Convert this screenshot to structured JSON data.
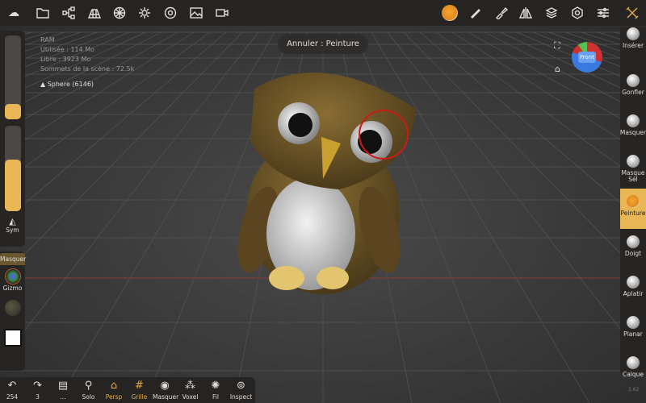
{
  "topbar": {
    "left_icons": [
      "nomad-logo-icon",
      "folder-icon",
      "scene-graph-icon",
      "topology-icon",
      "material-sphere-icon",
      "light-icon",
      "postprocess-icon",
      "image-background-icon",
      "camera-icon"
    ],
    "right_icons": [
      "material-preview-icon",
      "brush-stroke-icon",
      "paint-brush-icon",
      "symmetry-icon",
      "layers-icon",
      "settings-icon",
      "sliders-icon",
      "tools-icon"
    ]
  },
  "info": {
    "ram": "RAM",
    "used": "Utilisée : 114 Mo",
    "free": "Libre : 3923 Mo",
    "vertices": "Sommets de la scène : 72.5k",
    "object": "Sphere (6146)"
  },
  "undo_toast": "Annuler : Peinture",
  "view_cube": {
    "label": "Front"
  },
  "left_panel": {
    "size_fill": 0.18,
    "intensity_fill": 0.6,
    "sym": "Sym",
    "masquer": "Masquer",
    "gizmo": "Gizmo"
  },
  "right_tools": [
    {
      "label": "Insérer"
    },
    {
      "label": "Gonfler"
    },
    {
      "label": "Masquer"
    },
    {
      "label": "Masque Sél"
    },
    {
      "label": "Peinture",
      "active": true
    },
    {
      "label": "Doigt"
    },
    {
      "label": "Aplatir"
    },
    {
      "label": "Planar"
    },
    {
      "label": "Calque"
    }
  ],
  "version": "1.62",
  "bottom": [
    {
      "icon": "undo-icon",
      "label": "254"
    },
    {
      "icon": "redo-icon",
      "label": "3"
    },
    {
      "icon": "notes-icon",
      "label": "..."
    },
    {
      "icon": "search-icon",
      "label": "Solo"
    },
    {
      "icon": "perspective-icon",
      "label": "Persp",
      "on": true
    },
    {
      "icon": "grid-icon",
      "label": "Grille",
      "on": true
    },
    {
      "icon": "eye-icon",
      "label": "Masquer"
    },
    {
      "icon": "voxel-icon",
      "label": "Voxel"
    },
    {
      "icon": "wireframe-icon",
      "label": "Fil"
    },
    {
      "icon": "inspect-icon",
      "label": "Inspect"
    }
  ],
  "colors": {
    "accent": "#e9b655",
    "owl_body": "#6b5325",
    "brush_cursor": "#cc1a1a"
  }
}
